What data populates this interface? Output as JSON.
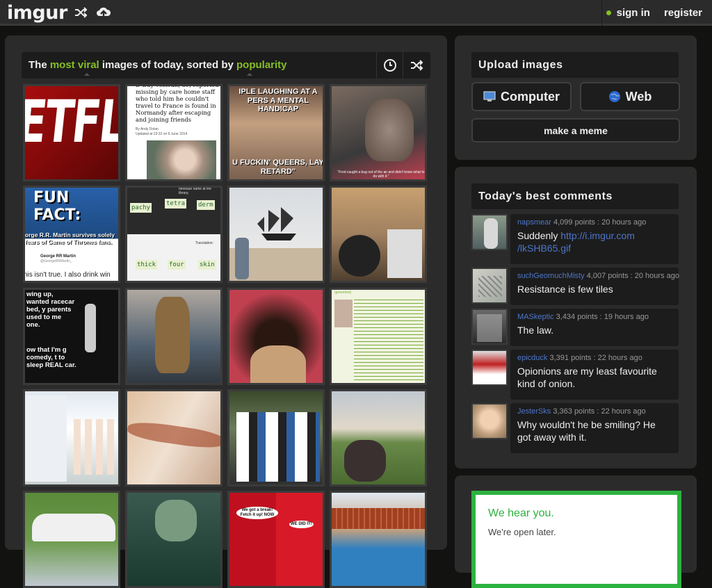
{
  "topbar": {
    "logo": "imgur",
    "icons": [
      "shuffle-icon",
      "upload-cloud-icon"
    ],
    "sign_in": "sign in",
    "register": "register"
  },
  "sortbar": {
    "prefix": "The",
    "highlight1": "most viral",
    "middle": "images of today, sorted by",
    "highlight2": "popularity"
  },
  "thumbnails": [
    {
      "caption": "ETFLIX"
    },
    {
      "caption": "D-Day veteran, 89, reported missing by care home staff who told him he couldn't travel to France is found in Normandy after escaping and joining friends",
      "byline": "By Andy Dolan",
      "date": "Updated at 23:32 on 6 June 2014"
    },
    {
      "caption": "IPLE LAUGHING AT A PERS A MENTAL HANDICAP",
      "bottom": "U FUCKIN' QUEERS, LAY RETARD\""
    },
    {
      "caption": "\"Fred caught a bug out of the air and didn't know what to do with it.\""
    },
    {
      "caption": "FUN FACT:",
      "bottom": "orge R.R. Martin survives solely fears of Game of Thrones fans.",
      "tweet_name": "George RR Martin",
      "tweet_handle": "@GeorgeRRMartin_",
      "tweet_text": "his isn't true. I also drink win"
    },
    {
      "caption": "dinosaur name at the library.",
      "words": [
        "pachy",
        "tetra",
        "derm",
        "thick",
        "four",
        "skin"
      ],
      "label": "Translation:"
    },
    {
      "caption": ""
    },
    {
      "caption": ""
    },
    {
      "caption": "wing up, wanted racecar bed, y parents used to me one.",
      "bottom": "ow that I'm g comedy, t to sleep REAL car."
    },
    {
      "caption": ""
    },
    {
      "caption": ""
    },
    {
      "caption": "(greentext)"
    },
    {
      "caption": ""
    },
    {
      "caption": ""
    },
    {
      "caption": ""
    },
    {
      "caption": ""
    },
    {
      "caption": ""
    },
    {
      "caption": ""
    },
    {
      "caption": "We got a break! Fetch it up! NOW",
      "bottom": "WE DID IT!"
    },
    {
      "caption": ""
    }
  ],
  "upload": {
    "title": "Upload images",
    "computer": "Computer",
    "web": "Web",
    "meme": "make a meme"
  },
  "comments": {
    "title": "Today's best comments",
    "items": [
      {
        "user": "napsmear",
        "meta": "4,099 points : 20 hours ago",
        "text": "Suddenly ",
        "link": "http://i.imgur.com /lkSHB65.gif"
      },
      {
        "user": "suchGeomuchMisty",
        "meta": "4,007 points : 20 hours ago",
        "text": "Resistance is few tiles",
        "link": ""
      },
      {
        "user": "MASkeptic",
        "meta": "3,434 points : 19 hours ago",
        "text": "The law.",
        "link": ""
      },
      {
        "user": "epicduck",
        "meta": "3,391 points : 22 hours ago",
        "text": "Opionions are my least favourite kind of onion.",
        "link": ""
      },
      {
        "user": "JesterSks",
        "meta": "3,363 points : 22 hours ago",
        "text": "Why wouldn't he be smiling? He got away with it.",
        "link": ""
      }
    ]
  },
  "ad": {
    "headline": "We hear you.",
    "sub": "We're open later."
  },
  "colors": {
    "accent": "#85bf25",
    "link": "#4e76c9",
    "panel": "#2b2b2b",
    "ad_border": "#2db23f"
  }
}
